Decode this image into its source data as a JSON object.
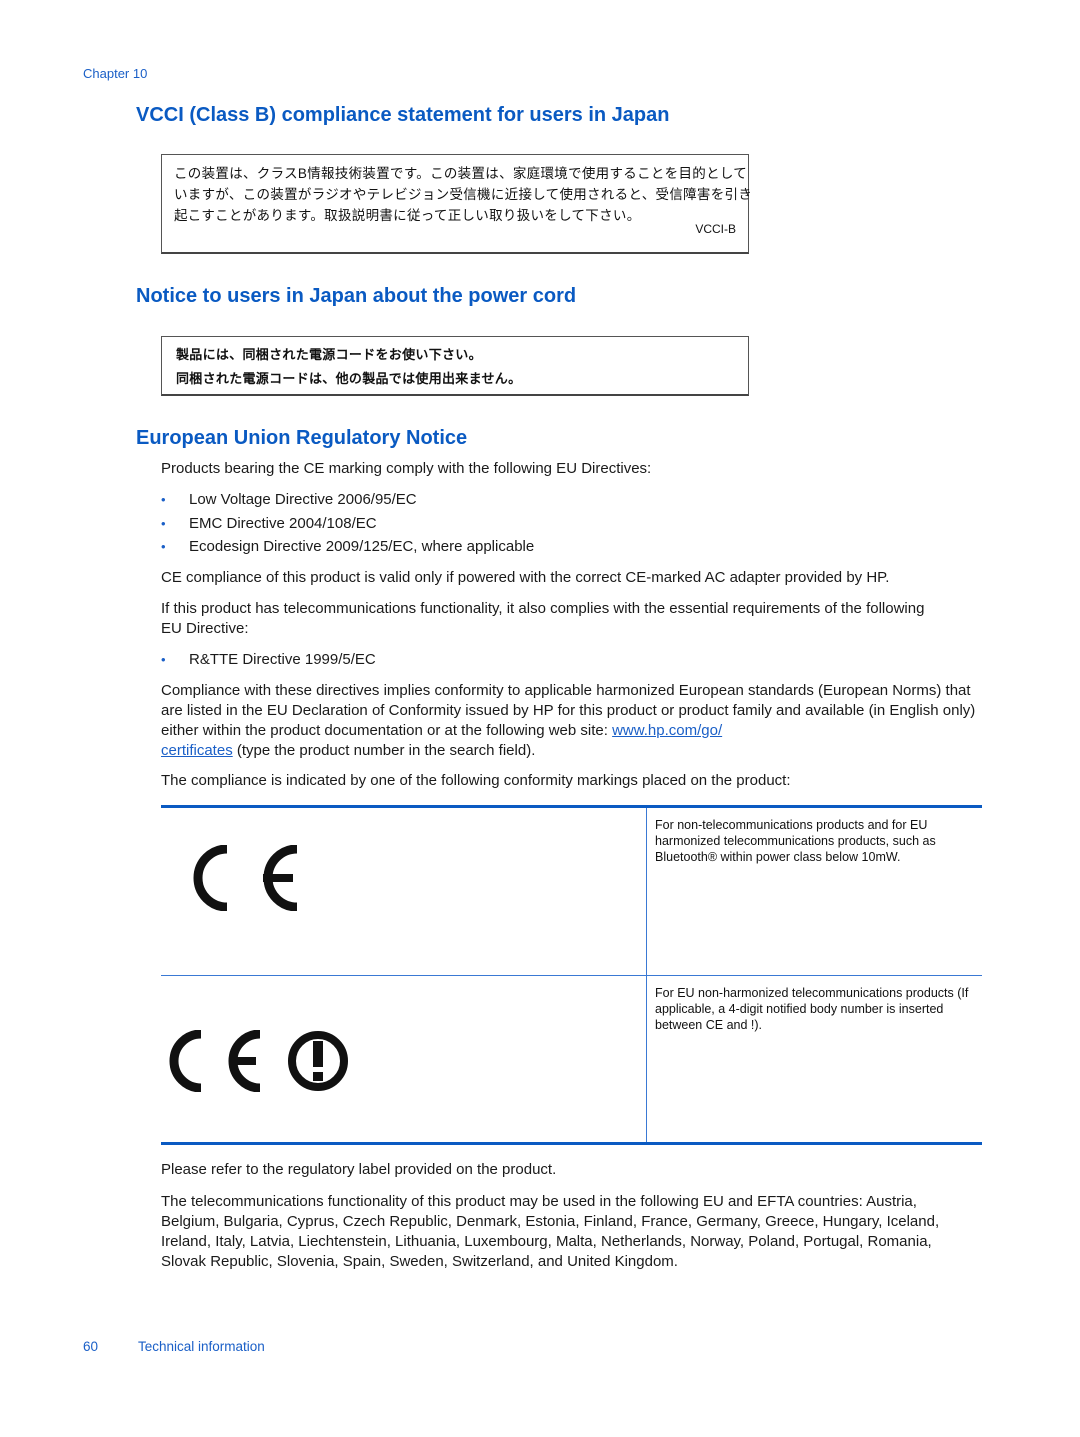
{
  "header": {
    "chapter": "Chapter 10"
  },
  "sections": {
    "vcci": {
      "heading": "VCCI (Class B) compliance statement for users in Japan",
      "notice_lines": [
        "この装置は、クラスB情報技術装置です。この装置は、家庭環境で使用することを目的として",
        "いますが、この装置がラジオやテレビジョン受信機に近接して使用されると、受信障害を引き",
        "起こすことがあります。取扱説明書に従って正しい取り扱いをして下さい。"
      ],
      "label": "VCCI-B"
    },
    "power_cord": {
      "heading": "Notice to users in Japan about the power cord",
      "notice_lines": [
        "製品には、同梱された電源コードをお使い下さい。",
        "同梱された電源コードは、他の製品では使用出来ません。"
      ]
    },
    "eu": {
      "heading": "European Union Regulatory Notice",
      "intro": "Products bearing the CE marking comply with the following EU Directives:",
      "directives": [
        "Low Voltage Directive 2006/95/EC",
        "EMC Directive 2004/108/EC",
        "Ecodesign Directive 2009/125/EC, where applicable"
      ],
      "ce_adapter": "CE compliance of this product is valid only if powered with the correct CE-marked AC adapter provided by HP.",
      "telecom_intro": "If this product has telecommunications functionality, it also complies with the essential requirements of the following EU Directive:",
      "telecom_directives": [
        "R&TTE Directive 1999/5/EC"
      ],
      "compliance_pre": "Compliance with these directives implies conformity to applicable harmonized European standards (European Norms) that are listed in the EU Declaration of Conformity issued by HP for this product or product family and available (in English only) either within the product documentation or at the following web site: ",
      "compliance_link": "www.hp.com/go/certificates",
      "compliance_link_part1": "www.hp.com/go/",
      "compliance_link_part2": "certificates",
      "compliance_post": " (type the product number in the search field).",
      "markings_intro": "The compliance is indicated by one of the following conformity markings placed on the product:",
      "markings_table": [
        {
          "mark": "CE",
          "icon": "ce-mark-icon",
          "description": "For non-telecommunications products and for EU harmonized telecommunications products, such as Bluetooth® within power class below 10mW."
        },
        {
          "mark": "CE !",
          "icon": "ce-alert-mark-icon",
          "description": "For EU non-harmonized telecommunications products (If applicable, a 4-digit notified body number is inserted between CE and !)."
        }
      ],
      "label_note": "Please refer to the regulatory label provided on the product.",
      "countries_intro": "The telecommunications functionality of this product may be used in the following EU and EFTA countries:",
      "countries": "Austria, Belgium, Bulgaria, Cyprus, Czech Republic, Denmark, Estonia, Finland, France, Germany, Greece, Hungary, Iceland, Ireland, Italy, Latvia, Liechtenstein, Lithuania, Luxembourg, Malta, Netherlands, Norway, Poland, Portugal, Romania, Slovak Republic, Slovenia, Spain, Sweden, Switzerland, and United Kingdom."
    }
  },
  "footer": {
    "page_number": "60",
    "section_title": "Technical information"
  },
  "colors": {
    "heading_blue": "#0a5ac2",
    "link_blue": "#1a5fc7",
    "rule_blue": "#0a5ac2"
  }
}
